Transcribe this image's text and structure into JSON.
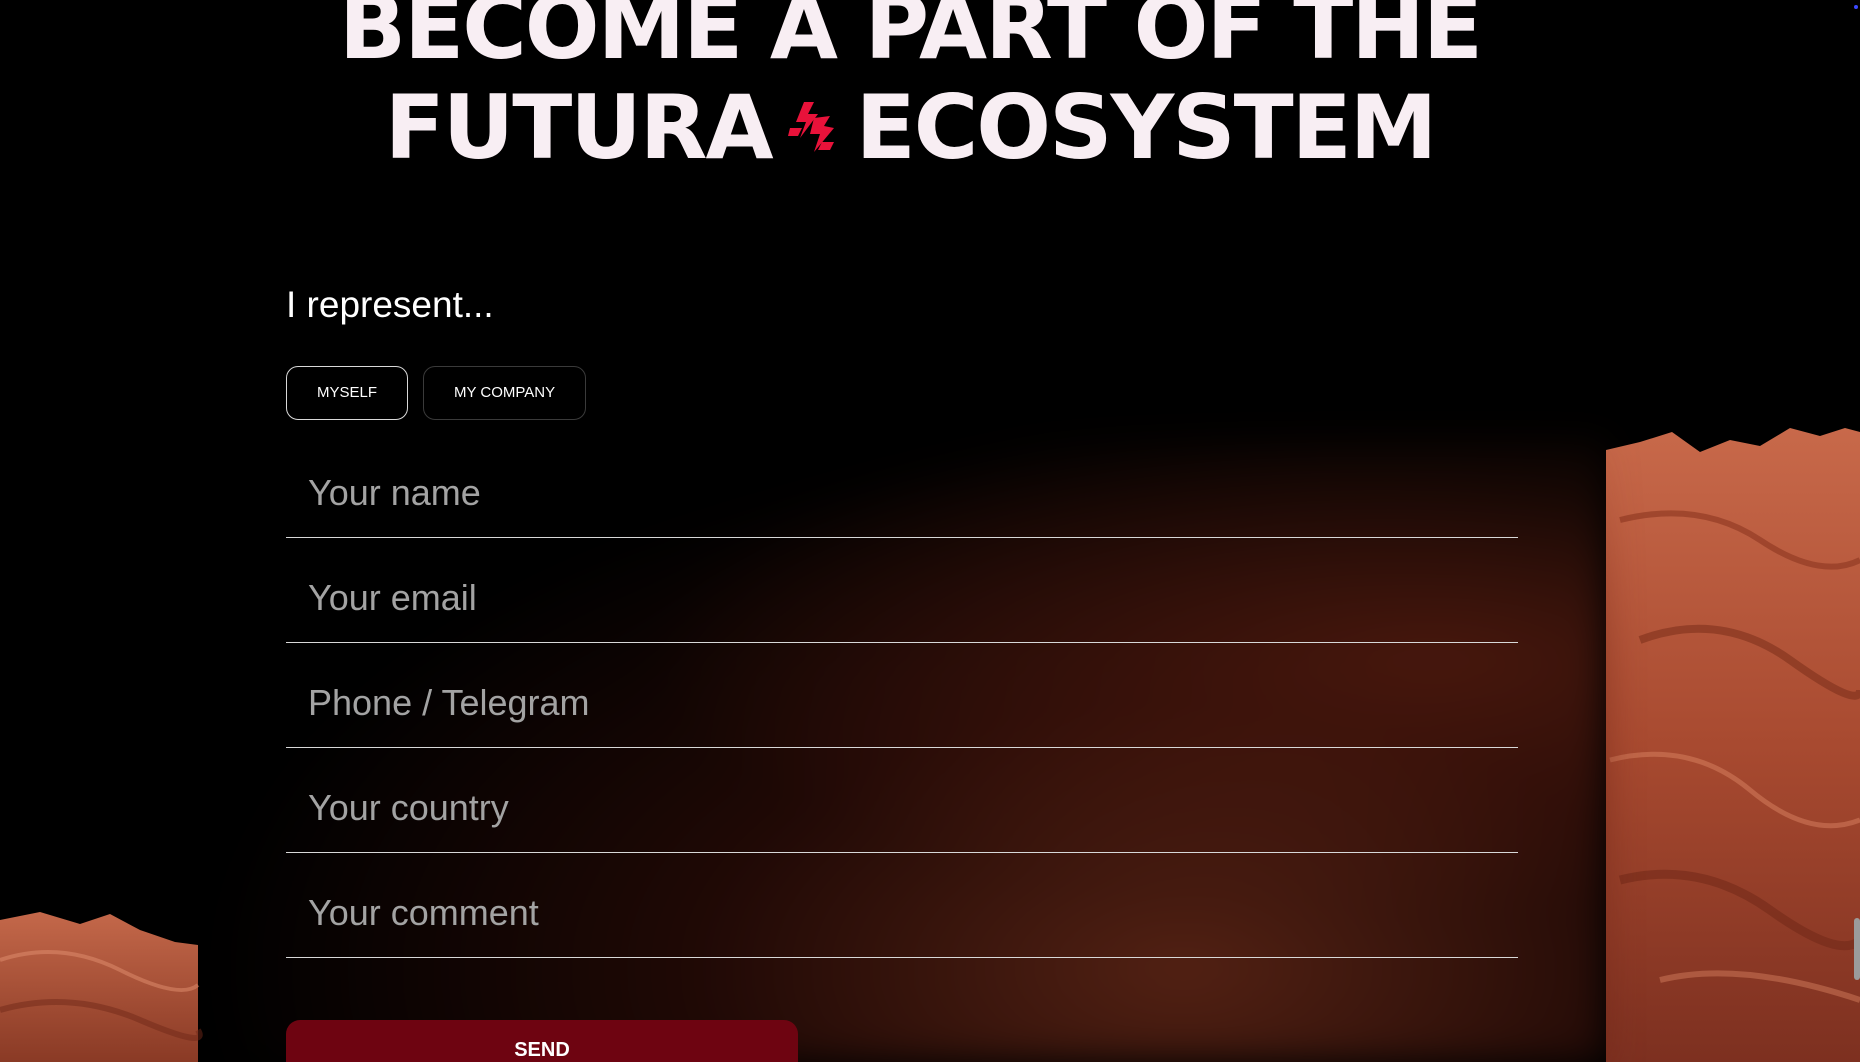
{
  "hero": {
    "line1": "BECOME A PART OF THE",
    "line2_left": "FUTURA",
    "line2_right": "ECOSYSTEM",
    "logo_icon": "futura-brand-mark",
    "logo_color": "#e8123a"
  },
  "form": {
    "represent_label": "I represent...",
    "choices": [
      {
        "label": "MYSELF",
        "selected": true
      },
      {
        "label": "MY COMPANY",
        "selected": false
      }
    ],
    "fields": [
      {
        "placeholder": "Your name",
        "value": ""
      },
      {
        "placeholder": "Your email",
        "value": ""
      },
      {
        "placeholder": "Phone / Telegram",
        "value": ""
      },
      {
        "placeholder": "Your country",
        "value": ""
      },
      {
        "placeholder": "Your comment",
        "value": ""
      }
    ],
    "submit_label": "SEND"
  },
  "colors": {
    "background": "#000000",
    "heading": "#f8eef3",
    "accent": "#e8123a",
    "button": "#6e0411",
    "terrain": "#b5553a"
  }
}
